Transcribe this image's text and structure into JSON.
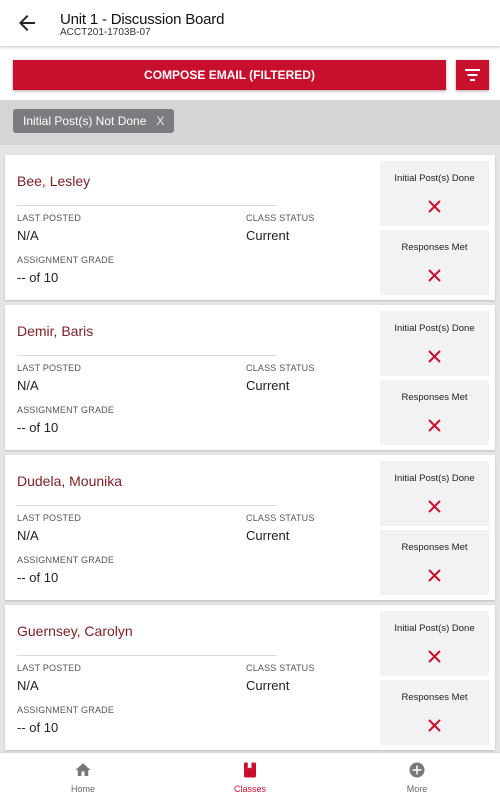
{
  "header": {
    "title": "Unit 1 - Discussion Board",
    "subtitle": "ACCT201-1703B-07",
    "back_icon": "arrow-left"
  },
  "actions": {
    "compose_label": "COMPOSE EMAIL (FILTERED)",
    "filter_icon": "filter-lines"
  },
  "filter_chip": {
    "label": "Initial Post(s) Not Done",
    "remove": "X"
  },
  "labels": {
    "last_posted": "LAST POSTED",
    "class_status": "CLASS STATUS",
    "assignment_grade": "ASSIGNMENT GRADE",
    "initial_posts": "Initial Post(s) Done",
    "responses": "Responses Met"
  },
  "students": [
    {
      "name": "Bee, Lesley",
      "last_posted": "N/A",
      "class_status": "Current",
      "grade": "-- of 10",
      "initial_done": false,
      "responses_met": false
    },
    {
      "name": "Demir, Baris",
      "last_posted": "N/A",
      "class_status": "Current",
      "grade": "-- of 10",
      "initial_done": false,
      "responses_met": false
    },
    {
      "name": "Dudela, Mounika",
      "last_posted": "N/A",
      "class_status": "Current",
      "grade": "-- of 10",
      "initial_done": false,
      "responses_met": false
    },
    {
      "name": "Guernsey, Carolyn",
      "last_posted": "N/A",
      "class_status": "Current",
      "grade": "-- of 10",
      "initial_done": false,
      "responses_met": false
    }
  ],
  "nav": {
    "items": [
      {
        "label": "Home",
        "icon": "home-icon",
        "active": false
      },
      {
        "label": "Classes",
        "icon": "book-icon",
        "active": true
      },
      {
        "label": "More",
        "icon": "plus-circle-icon",
        "active": false
      }
    ]
  },
  "colors": {
    "accent": "#c8102e",
    "name": "#7b1f24",
    "chip": "#7a7c7f"
  }
}
